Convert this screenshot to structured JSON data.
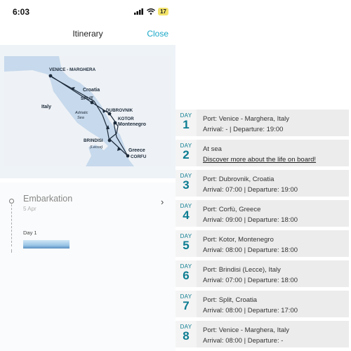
{
  "status_bar": {
    "time": "6:03",
    "battery": "17"
  },
  "nav": {
    "title": "Itinerary",
    "close_label": "Close"
  },
  "map": {
    "labels": {
      "venice": "VENICE - MARGHERA",
      "croatia": "Croatia",
      "split": "SPLIT",
      "italy": "Italy",
      "adriatic": "Adriatic",
      "sea": "Sea",
      "dubrovnik": "DUBROVNIK",
      "kotor": "KOTOR",
      "montenegro": "Montenegro",
      "brindisi": "BRINDISI",
      "lecce": "(Lecce)",
      "greece": "Greece",
      "corfu": "CORFU"
    }
  },
  "embarkation": {
    "title": "Embarkation",
    "date": "5 Apr",
    "day_label": "Day 1"
  },
  "itinerary": {
    "day_word": "DAY",
    "days": [
      {
        "num": "1",
        "line1": "Port: Venice - Marghera, Italy",
        "line2": "Arrival: - | Departure: 19:00"
      },
      {
        "num": "2",
        "line1": "At sea",
        "line2": "Discover more about the life on board!"
      },
      {
        "num": "3",
        "line1": "Port: Dubrovnik, Croatia",
        "line2": "Arrival: 07:00 | Departure: 19:00"
      },
      {
        "num": "4",
        "line1": "Port: Corfù, Greece",
        "line2": "Arrival: 09:00 | Departure: 18:00"
      },
      {
        "num": "5",
        "line1": "Port: Kotor, Montenegro",
        "line2": "Arrival: 08:00 | Departure: 18:00"
      },
      {
        "num": "6",
        "line1": "Port: Brindisi (Lecce), Italy",
        "line2": "Arrival: 07:00 | Departure: 18:00"
      },
      {
        "num": "7",
        "line1": "Port: Split, Croatia",
        "line2": "Arrival: 08:00 | Departure: 17:00"
      },
      {
        "num": "8",
        "line1": "Port: Venice - Marghera, Italy",
        "line2": "Arrival: 08:00 | Departure: -"
      }
    ]
  }
}
